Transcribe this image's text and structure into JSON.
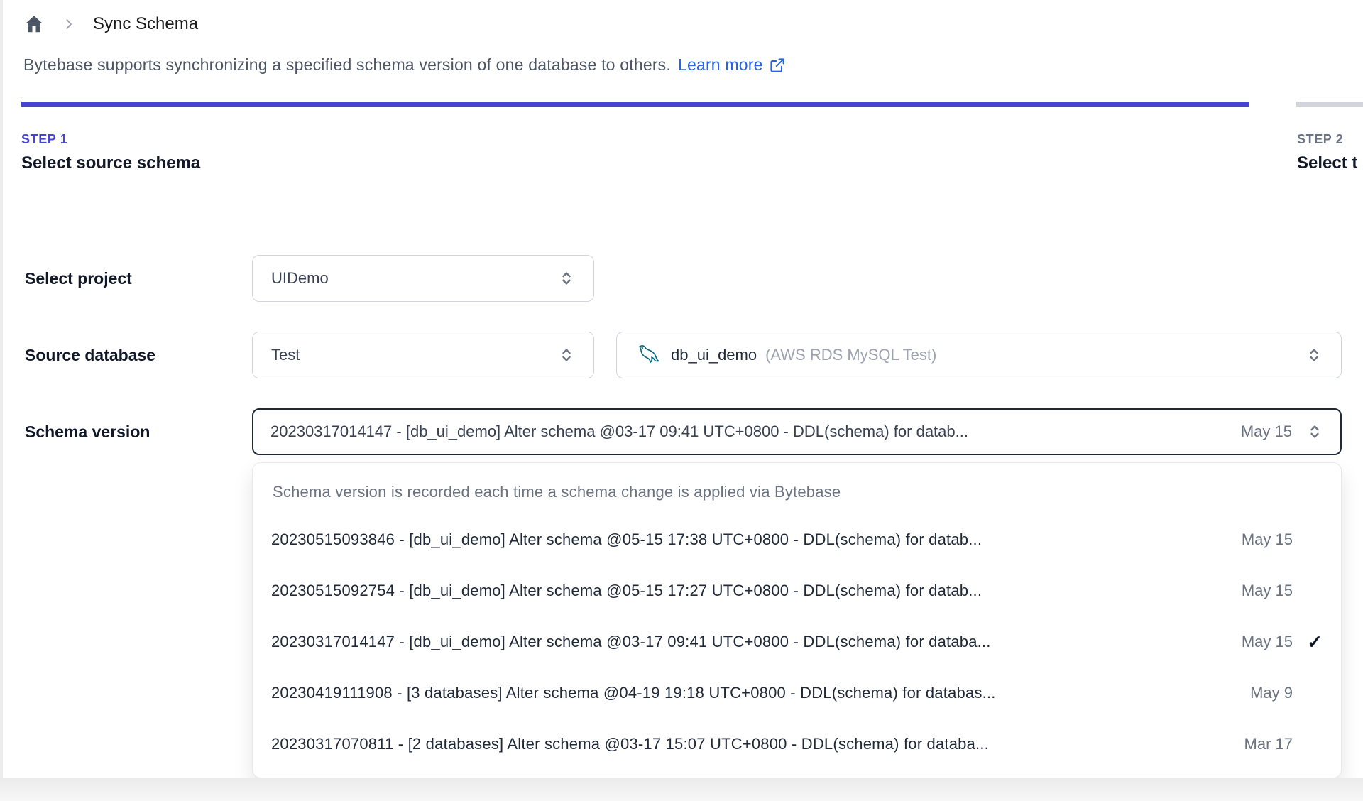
{
  "breadcrumb": {
    "title": "Sync Schema"
  },
  "intro": {
    "text": "Bytebase supports synchronizing a specified schema version of one database to others.",
    "link_label": "Learn more"
  },
  "steps": [
    {
      "label": "STEP 1",
      "title": "Select source schema",
      "active": true
    },
    {
      "label": "STEP 2",
      "title": "Select t",
      "active": false
    }
  ],
  "form": {
    "project": {
      "label": "Select project",
      "value": "UIDemo"
    },
    "source_database": {
      "label": "Source database",
      "environment": "Test",
      "database": "db_ui_demo",
      "database_note": "(AWS RDS MySQL Test)"
    },
    "schema_version": {
      "label": "Schema version",
      "value": "20230317014147 - [db_ui_demo] Alter schema @03-17 09:41 UTC+0800 - DDL(schema) for datab...",
      "date": "May 15"
    }
  },
  "dropdown": {
    "header": "Schema version is recorded each time a schema change is applied via Bytebase",
    "options": [
      {
        "text": "20230515093846 - [db_ui_demo] Alter schema @05-15 17:38 UTC+0800 - DDL(schema) for datab...",
        "date": "May 15",
        "selected": false
      },
      {
        "text": "20230515092754 - [db_ui_demo] Alter schema @05-15 17:27 UTC+0800 - DDL(schema) for datab...",
        "date": "May 15",
        "selected": false
      },
      {
        "text": "20230317014147 - [db_ui_demo] Alter schema @03-17 09:41 UTC+0800 - DDL(schema) for databa...",
        "date": "May 15",
        "selected": true
      },
      {
        "text": "20230419111908 - [3 databases] Alter schema @04-19 19:18 UTC+0800 - DDL(schema) for databas...",
        "date": "May 9",
        "selected": false
      },
      {
        "text": "20230317070811 - [2 databases] Alter schema @03-17 15:07 UTC+0800 - DDL(schema) for databa...",
        "date": "Mar 17",
        "selected": false
      }
    ]
  },
  "icons": {
    "check": "✓"
  },
  "colors": {
    "accent": "#4744d4",
    "link": "#2563eb",
    "bar_inactive": "#d1d5db",
    "mysql_icon": "#00677f"
  }
}
